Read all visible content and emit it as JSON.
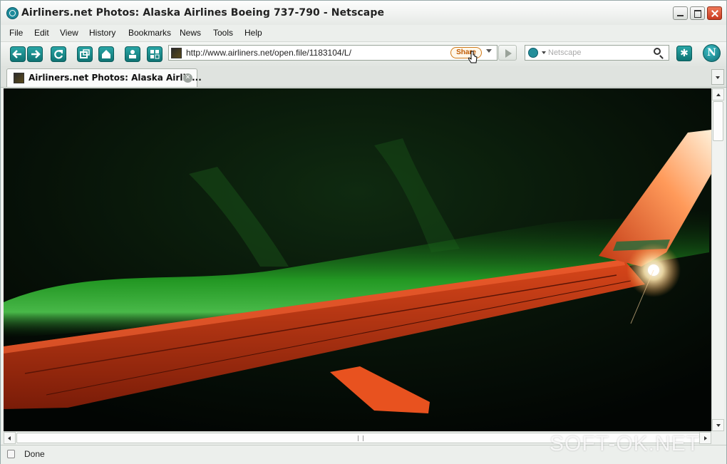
{
  "window": {
    "title": "Airliners.net Photos: Alaska Airlines Boeing 737-790 - Netscape"
  },
  "menu": [
    "File",
    "Edit",
    "View",
    "History",
    "Bookmarks",
    "News",
    "Tools",
    "Help"
  ],
  "toolbar": {
    "url": "http://www.airliners.net/open.file/1183104/L/",
    "share_label": "Share",
    "search_placeholder": "Netscape",
    "netscape_logo": "N"
  },
  "tabs": [
    {
      "label": "Airliners.net Photos: Alaska Airlin...",
      "active": true
    }
  ],
  "status": {
    "text": "Done"
  },
  "watermark": "SOFT-OK.NET",
  "colors": {
    "accent": "#1d8a9a",
    "wing": "#c43a14",
    "aurora": "#3fd23f"
  }
}
